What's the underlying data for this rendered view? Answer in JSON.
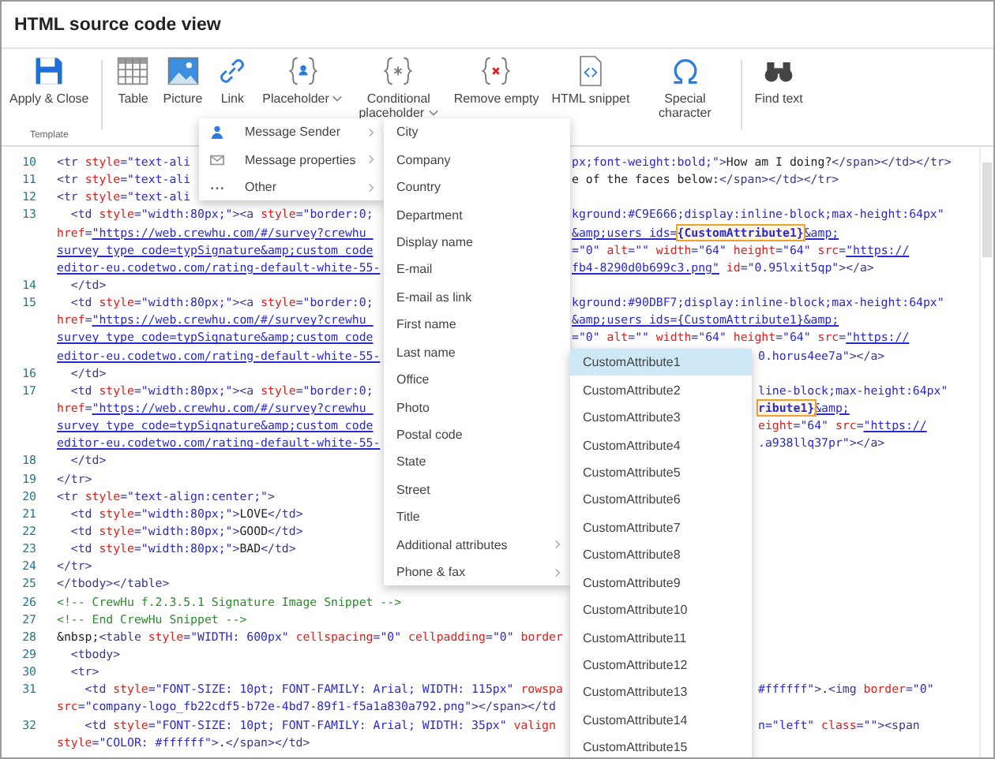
{
  "window": {
    "title": "HTML source code view"
  },
  "toolbar": {
    "groups": [
      {
        "label": "Template",
        "buttons": [
          {
            "label": "Apply & Close",
            "kind": "save",
            "dropdown": false
          }
        ]
      },
      {
        "buttons": [
          {
            "label": "Table",
            "kind": "table",
            "dropdown": false
          },
          {
            "label": "Picture",
            "kind": "picture",
            "dropdown": false
          },
          {
            "label": "Link",
            "kind": "link",
            "dropdown": false
          },
          {
            "label": "Placeholder",
            "kind": "placeholder",
            "dropdown": true
          },
          {
            "label": "Conditional placeholder",
            "kind": "conditional",
            "dropdown": true
          },
          {
            "label": "Remove empty",
            "kind": "remove",
            "dropdown": false
          },
          {
            "label": "HTML snippet",
            "kind": "snippet",
            "dropdown": false
          },
          {
            "label": "Special character",
            "kind": "special",
            "dropdown": false
          }
        ]
      },
      {
        "buttons": [
          {
            "label": "Find text",
            "kind": "find",
            "dropdown": false
          }
        ]
      }
    ]
  },
  "code": {
    "rows": [
      {
        "number": "10",
        "left": [
          {
            "kind": "tag",
            "text": "<tr "
          },
          {
            "kind": "attr",
            "text": "style"
          },
          {
            "kind": "tag",
            "text": "="
          },
          {
            "kind": "val",
            "text": "\"text-ali"
          }
        ],
        "mid": [
          {
            "kind": "val",
            "text": "px;font-weight:bold;\""
          },
          {
            "kind": "tag",
            "text": ">"
          },
          {
            "kind": "txt",
            "text": "How am I doing?"
          },
          {
            "kind": "tag",
            "text": "</span></td></tr>"
          }
        ]
      },
      {
        "number": "11",
        "left": [
          {
            "kind": "tag",
            "text": "<tr "
          },
          {
            "kind": "attr",
            "text": "style"
          },
          {
            "kind": "tag",
            "text": "="
          },
          {
            "kind": "val",
            "text": "\"text-ali"
          }
        ],
        "mid": [
          {
            "kind": "txt",
            "text": "e of the faces below:"
          },
          {
            "kind": "tag",
            "text": "</span></td></tr>"
          }
        ]
      },
      {
        "number": "12",
        "left": [
          {
            "kind": "tag",
            "text": "<tr "
          },
          {
            "kind": "attr",
            "text": "style"
          },
          {
            "kind": "tag",
            "text": "="
          },
          {
            "kind": "val",
            "text": "\"text-ali"
          }
        ]
      },
      {
        "number": "13",
        "left": [
          {
            "kind": "tag",
            "text": "  <td "
          },
          {
            "kind": "attr",
            "text": "style"
          },
          {
            "kind": "tag",
            "text": "="
          },
          {
            "kind": "val",
            "text": "\"width:80px;\""
          },
          {
            "kind": "tag",
            "text": "><a "
          },
          {
            "kind": "attr",
            "text": "style"
          },
          {
            "kind": "tag",
            "text": "="
          },
          {
            "kind": "val",
            "text": "\"border:0;"
          }
        ],
        "mid": [
          {
            "kind": "val",
            "text": "kground:#C9E666;display:inline-block;max-height:64px\""
          }
        ]
      },
      {
        "left": [
          {
            "kind": "attr",
            "text": "href"
          },
          {
            "kind": "tag",
            "text": "="
          },
          {
            "kind": "link",
            "text": "\"https://web.crewhu.com/#/survey?crewhu_"
          }
        ],
        "mid": [
          {
            "kind": "link",
            "text": "&amp;users_ids="
          },
          {
            "kind": "hl",
            "text": "{CustomAttribute1}"
          },
          {
            "kind": "link",
            "text": "&amp;"
          }
        ]
      },
      {
        "left": [
          {
            "kind": "link",
            "text": "survey_type_code=typSignature&amp;custom_code"
          }
        ],
        "mid": [
          {
            "kind": "val",
            "text": "=\"0\" "
          },
          {
            "kind": "attr",
            "text": "alt"
          },
          {
            "kind": "tag",
            "text": "="
          },
          {
            "kind": "val",
            "text": "\"\" "
          },
          {
            "kind": "attr",
            "text": "width"
          },
          {
            "kind": "tag",
            "text": "="
          },
          {
            "kind": "val",
            "text": "\"64\" "
          },
          {
            "kind": "attr",
            "text": "height"
          },
          {
            "kind": "tag",
            "text": "="
          },
          {
            "kind": "val",
            "text": "\"64\" "
          },
          {
            "kind": "attr",
            "text": "src"
          },
          {
            "kind": "tag",
            "text": "="
          },
          {
            "kind": "link",
            "text": "\"https://"
          }
        ]
      },
      {
        "left": [
          {
            "kind": "link",
            "text": "editor-eu.codetwo.com/rating-default-white-55-"
          }
        ],
        "mid": [
          {
            "kind": "link",
            "text": "fb4-8290d0b699c3.png\""
          },
          {
            "kind": "attr",
            "text": " id"
          },
          {
            "kind": "tag",
            "text": "="
          },
          {
            "kind": "val",
            "text": "\"0.95lxit5qp\""
          },
          {
            "kind": "tag",
            "text": "></a>"
          }
        ]
      },
      {
        "number": "14",
        "left": [
          {
            "kind": "tag",
            "text": "  </td>"
          }
        ]
      },
      {
        "number": "15",
        "left": [
          {
            "kind": "tag",
            "text": "  <td "
          },
          {
            "kind": "attr",
            "text": "style"
          },
          {
            "kind": "tag",
            "text": "="
          },
          {
            "kind": "val",
            "text": "\"width:80px;\""
          },
          {
            "kind": "tag",
            "text": "><a "
          },
          {
            "kind": "attr",
            "text": "style"
          },
          {
            "kind": "tag",
            "text": "="
          },
          {
            "kind": "val",
            "text": "\"border:0;"
          }
        ],
        "mid": [
          {
            "kind": "val",
            "text": "kground:#90DBF7;display:inline-block;max-height:64px\""
          }
        ]
      },
      {
        "left": [
          {
            "kind": "attr",
            "text": "href"
          },
          {
            "kind": "tag",
            "text": "="
          },
          {
            "kind": "link",
            "text": "\"https://web.crewhu.com/#/survey?crewhu_"
          }
        ],
        "mid": [
          {
            "kind": "link",
            "text": "&amp;users_ids={CustomAttribute1}&amp;"
          }
        ]
      },
      {
        "left": [
          {
            "kind": "link",
            "text": "survey_type_code=typSignature&amp;custom_code"
          }
        ],
        "mid": [
          {
            "kind": "val",
            "text": "=\"0\" "
          },
          {
            "kind": "attr",
            "text": "alt"
          },
          {
            "kind": "tag",
            "text": "="
          },
          {
            "kind": "val",
            "text": "\"\" "
          },
          {
            "kind": "attr",
            "text": "width"
          },
          {
            "kind": "tag",
            "text": "="
          },
          {
            "kind": "val",
            "text": "\"64\" "
          },
          {
            "kind": "attr",
            "text": "height"
          },
          {
            "kind": "tag",
            "text": "="
          },
          {
            "kind": "val",
            "text": "\"64\" "
          },
          {
            "kind": "attr",
            "text": "src"
          },
          {
            "kind": "tag",
            "text": "="
          },
          {
            "kind": "link",
            "text": "\"https://"
          }
        ]
      },
      {
        "left": [
          {
            "kind": "link",
            "text": "editor-eu.codetwo.com/rating-default-white-55-"
          }
        ],
        "far": [
          {
            "kind": "val",
            "text": "0.horus4ee7a\""
          },
          {
            "kind": "tag",
            "text": "></a>"
          }
        ]
      },
      {
        "number": "16",
        "left": [
          {
            "kind": "tag",
            "text": "  </td>"
          }
        ]
      },
      {
        "number": "17",
        "left": [
          {
            "kind": "tag",
            "text": "  <td "
          },
          {
            "kind": "attr",
            "text": "style"
          },
          {
            "kind": "tag",
            "text": "="
          },
          {
            "kind": "val",
            "text": "\"width:80px;\""
          },
          {
            "kind": "tag",
            "text": "><a "
          },
          {
            "kind": "attr",
            "text": "style"
          },
          {
            "kind": "tag",
            "text": "="
          },
          {
            "kind": "val",
            "text": "\"border:0;"
          }
        ],
        "far": [
          {
            "kind": "val",
            "text": "line-block;max-height:64px\""
          }
        ]
      },
      {
        "left": [
          {
            "kind": "attr",
            "text": "href"
          },
          {
            "kind": "tag",
            "text": "="
          },
          {
            "kind": "link",
            "text": "\"https://web.crewhu.com/#/survey?crewhu_"
          }
        ],
        "far": [
          {
            "kind": "hl",
            "text": "ribute1}"
          },
          {
            "kind": "link",
            "text": "&amp;"
          }
        ]
      },
      {
        "left": [
          {
            "kind": "link",
            "text": "survey_type_code=typSignature&amp;custom_code"
          }
        ],
        "far": [
          {
            "kind": "attr",
            "text": "eight"
          },
          {
            "kind": "tag",
            "text": "="
          },
          {
            "kind": "val",
            "text": "\"64\" "
          },
          {
            "kind": "attr",
            "text": "src"
          },
          {
            "kind": "tag",
            "text": "="
          },
          {
            "kind": "link",
            "text": "\"https://"
          }
        ]
      },
      {
        "left": [
          {
            "kind": "link",
            "text": "editor-eu.codetwo.com/rating-default-white-55-"
          }
        ],
        "far": [
          {
            "kind": "val",
            "text": ".a938llq37pr\""
          },
          {
            "kind": "tag",
            "text": "></a>"
          }
        ]
      },
      {
        "number": "18",
        "left": [
          {
            "kind": "tag",
            "text": "  </td>"
          }
        ]
      },
      {
        "number": "19",
        "left": [
          {
            "kind": "tag",
            "text": "</tr>"
          }
        ]
      },
      {
        "number": "20",
        "left": [
          {
            "kind": "tag",
            "text": "<tr "
          },
          {
            "kind": "attr",
            "text": "style"
          },
          {
            "kind": "tag",
            "text": "="
          },
          {
            "kind": "val",
            "text": "\"text-align:center;\""
          },
          {
            "kind": "tag",
            "text": ">"
          }
        ]
      },
      {
        "number": "21",
        "left": [
          {
            "kind": "tag",
            "text": "  <td "
          },
          {
            "kind": "attr",
            "text": "style"
          },
          {
            "kind": "tag",
            "text": "="
          },
          {
            "kind": "val",
            "text": "\"width:80px;\""
          },
          {
            "kind": "tag",
            "text": ">"
          },
          {
            "kind": "txt",
            "text": "LOVE"
          },
          {
            "kind": "tag",
            "text": "</td>"
          }
        ]
      },
      {
        "number": "22",
        "left": [
          {
            "kind": "tag",
            "text": "  <td "
          },
          {
            "kind": "attr",
            "text": "style"
          },
          {
            "kind": "tag",
            "text": "="
          },
          {
            "kind": "val",
            "text": "\"width:80px;\""
          },
          {
            "kind": "tag",
            "text": ">"
          },
          {
            "kind": "txt",
            "text": "GOOD"
          },
          {
            "kind": "tag",
            "text": "</td>"
          }
        ]
      },
      {
        "number": "23",
        "left": [
          {
            "kind": "tag",
            "text": "  <td "
          },
          {
            "kind": "attr",
            "text": "style"
          },
          {
            "kind": "tag",
            "text": "="
          },
          {
            "kind": "val",
            "text": "\"width:80px;\""
          },
          {
            "kind": "tag",
            "text": ">"
          },
          {
            "kind": "txt",
            "text": "BAD"
          },
          {
            "kind": "tag",
            "text": "</td>"
          }
        ]
      },
      {
        "number": "24",
        "left": [
          {
            "kind": "tag",
            "text": "</tr>"
          }
        ]
      },
      {
        "number": "25",
        "left": [
          {
            "kind": "tag",
            "text": "</tbody></table>"
          }
        ]
      },
      {
        "number": "26",
        "left": [
          {
            "kind": "cmt",
            "text": "<!-- CrewHu f.2.3.5.1 Signature Image Snippet -->"
          }
        ]
      },
      {
        "number": "27",
        "left": [
          {
            "kind": "cmt",
            "text": "<!-- End CrewHu Snippet -->"
          }
        ]
      },
      {
        "number": "28",
        "left": [
          {
            "kind": "txt",
            "text": "&nbsp;"
          },
          {
            "kind": "tag",
            "text": "<table "
          },
          {
            "kind": "attr",
            "text": "style"
          },
          {
            "kind": "tag",
            "text": "="
          },
          {
            "kind": "val",
            "text": "\"WIDTH: 600px\" "
          },
          {
            "kind": "attr",
            "text": "cellspacing"
          },
          {
            "kind": "tag",
            "text": "="
          },
          {
            "kind": "val",
            "text": "\"0\" "
          },
          {
            "kind": "attr",
            "text": "cellpadding"
          },
          {
            "kind": "tag",
            "text": "="
          },
          {
            "kind": "val",
            "text": "\"0\" "
          },
          {
            "kind": "attr",
            "text": "border"
          }
        ]
      },
      {
        "number": "29",
        "left": [
          {
            "kind": "tag",
            "text": "  <tbody>"
          }
        ]
      },
      {
        "number": "30",
        "left": [
          {
            "kind": "tag",
            "text": "  <tr>"
          }
        ]
      },
      {
        "number": "31",
        "left": [
          {
            "kind": "tag",
            "text": "    <td "
          },
          {
            "kind": "attr",
            "text": "style"
          },
          {
            "kind": "tag",
            "text": "="
          },
          {
            "kind": "val",
            "text": "\"FONT-SIZE: 10pt; FONT-FAMILY: Arial; WIDTH: 115px\" "
          },
          {
            "kind": "attr",
            "text": "rowspa"
          }
        ],
        "far": [
          {
            "kind": "val",
            "text": "#ffffff\""
          },
          {
            "kind": "tag",
            "text": ">"
          },
          {
            "kind": "txt",
            "text": "."
          },
          {
            "kind": "tag",
            "text": "<img "
          },
          {
            "kind": "attr",
            "text": "border"
          },
          {
            "kind": "tag",
            "text": "="
          },
          {
            "kind": "val",
            "text": "\"0\""
          }
        ]
      },
      {
        "left": [
          {
            "kind": "attr",
            "text": "src"
          },
          {
            "kind": "tag",
            "text": "="
          },
          {
            "kind": "val",
            "text": "\"company-logo_fb22cdf5-b72e-4bd7-89f1-f5a1a830a792.png\""
          },
          {
            "kind": "tag",
            "text": "></span></td"
          }
        ]
      },
      {
        "number": "32",
        "left": [
          {
            "kind": "tag",
            "text": "    <td "
          },
          {
            "kind": "attr",
            "text": "style"
          },
          {
            "kind": "tag",
            "text": "="
          },
          {
            "kind": "val",
            "text": "\"FONT-SIZE: 10pt; FONT-FAMILY: Arial; WIDTH: 35px\" "
          },
          {
            "kind": "attr",
            "text": "valign"
          }
        ],
        "far": [
          {
            "kind": "val",
            "text": "n=\"left\" "
          },
          {
            "kind": "attr",
            "text": "class"
          },
          {
            "kind": "tag",
            "text": "="
          },
          {
            "kind": "val",
            "text": "\"\""
          },
          {
            "kind": "tag",
            "text": "><span"
          }
        ]
      },
      {
        "left": [
          {
            "kind": "attr",
            "text": "style"
          },
          {
            "kind": "tag",
            "text": "="
          },
          {
            "kind": "val",
            "text": "\"COLOR: #ffffff\""
          },
          {
            "kind": "tag",
            "text": ">"
          },
          {
            "kind": "txt",
            "text": "."
          },
          {
            "kind": "tag",
            "text": "</span></td>"
          }
        ]
      }
    ]
  },
  "placeholder_menu": {
    "items": [
      {
        "label": "Message Sender",
        "kind": "person",
        "submenu": true
      },
      {
        "label": "Message properties",
        "kind": "envelope",
        "submenu": true
      },
      {
        "label": "Other",
        "kind": "more",
        "submenu": true
      }
    ]
  },
  "sender_menu": {
    "items": [
      {
        "label": "City",
        "submenu": false
      },
      {
        "label": "Company",
        "submenu": false
      },
      {
        "label": "Country",
        "submenu": false
      },
      {
        "label": "Department",
        "submenu": false
      },
      {
        "label": "Display name",
        "submenu": false
      },
      {
        "label": "E-mail",
        "submenu": false
      },
      {
        "label": "E-mail as link",
        "submenu": false
      },
      {
        "label": "First name",
        "submenu": false
      },
      {
        "label": "Last name",
        "submenu": false
      },
      {
        "label": "Office",
        "submenu": false
      },
      {
        "label": "Photo",
        "submenu": false
      },
      {
        "label": "Postal code",
        "submenu": false
      },
      {
        "label": "State",
        "submenu": false
      },
      {
        "label": "Street",
        "submenu": false
      },
      {
        "label": "Title",
        "submenu": false
      },
      {
        "label": "Additional attributes",
        "submenu": true
      },
      {
        "label": "Phone & fax",
        "submenu": true
      }
    ]
  },
  "attributes_menu": {
    "items": [
      {
        "label": "CustomAttribute1",
        "selected": true
      },
      {
        "label": "CustomAttribute2",
        "selected": false
      },
      {
        "label": "CustomAttribute3",
        "selected": false
      },
      {
        "label": "CustomAttribute4",
        "selected": false
      },
      {
        "label": "CustomAttribute5",
        "selected": false
      },
      {
        "label": "CustomAttribute6",
        "selected": false
      },
      {
        "label": "CustomAttribute7",
        "selected": false
      },
      {
        "label": "CustomAttribute8",
        "selected": false
      },
      {
        "label": "CustomAttribute9",
        "selected": false
      },
      {
        "label": "CustomAttribute10",
        "selected": false
      },
      {
        "label": "CustomAttribute11",
        "selected": false
      },
      {
        "label": "CustomAttribute12",
        "selected": false
      },
      {
        "label": "CustomAttribute13",
        "selected": false
      },
      {
        "label": "CustomAttribute14",
        "selected": false
      },
      {
        "label": "CustomAttribute15",
        "selected": false
      }
    ]
  }
}
